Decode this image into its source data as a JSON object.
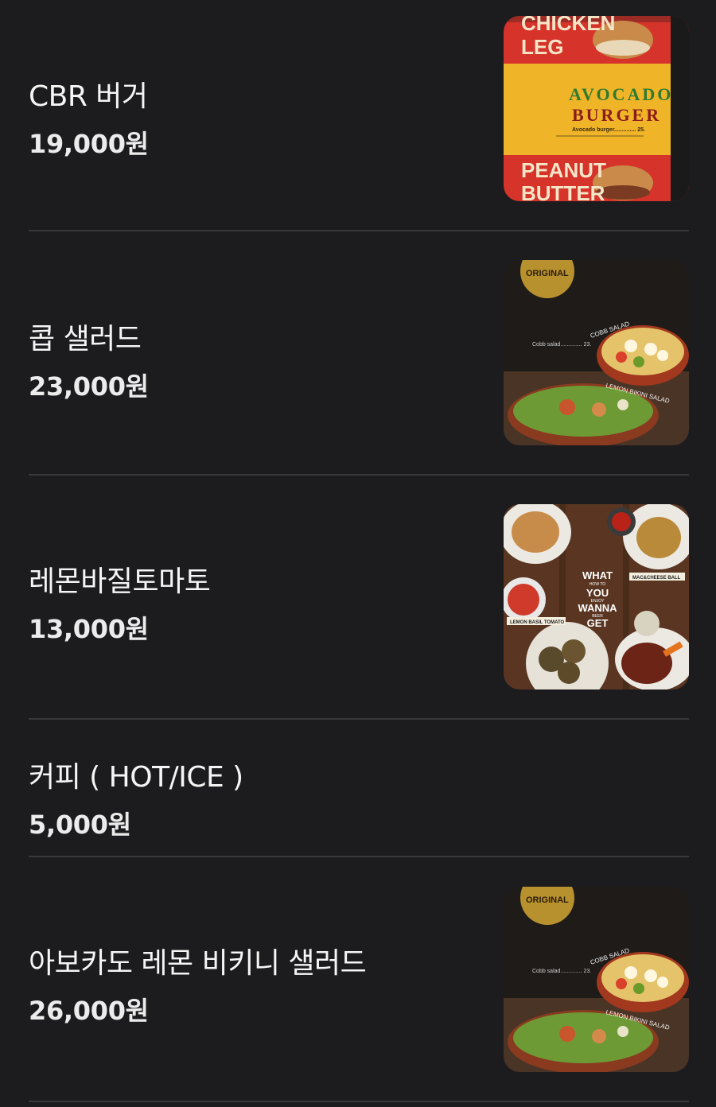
{
  "items": [
    {
      "name": "CBR 버거",
      "price": "19,000원",
      "image": "avocado-burger-menu-photo"
    },
    {
      "name": "콥 샐러드",
      "price": "23,000원",
      "image": "cobb-salad-menu-photo"
    },
    {
      "name": "레몬바질토마토",
      "price": "13,000원",
      "image": "snack-platter-menu-photo"
    },
    {
      "name": "커피 ( HOT/ICE )",
      "price": "5,000원",
      "image": null
    },
    {
      "name": "아보카도 레몬 비키니 샐러드",
      "price": "26,000원",
      "image": "cobb-salad-menu-photo"
    }
  ],
  "photos": {
    "burger": {
      "top_text": "CHICKEN",
      "top_text2": "LEG",
      "mid_title1": "AVOCADO",
      "mid_title2": "BURGER",
      "mid_caption": "Avocado burger.............. 25.",
      "bottom_text": "PEANUT",
      "bottom_text2": "BUTTER"
    },
    "salad": {
      "badge": "ORIGINAL",
      "label1": "COBB SALAD",
      "label2": "LEMON BIKINI SALAD",
      "caption": "Cobb salad.............. 23."
    },
    "snack": {
      "center_text": [
        "WHAT",
        "YOU",
        "WANNA",
        "GET"
      ],
      "small_text": [
        "HOW TO",
        "ENJOY",
        "BEER"
      ],
      "tag1": "MAC&CHEESE BALL",
      "tag2": "LEMON BASIL TOMATO"
    }
  },
  "colors": {
    "background": "#1c1c1e",
    "divider": "#38383a",
    "text": "#f5f5f5"
  }
}
